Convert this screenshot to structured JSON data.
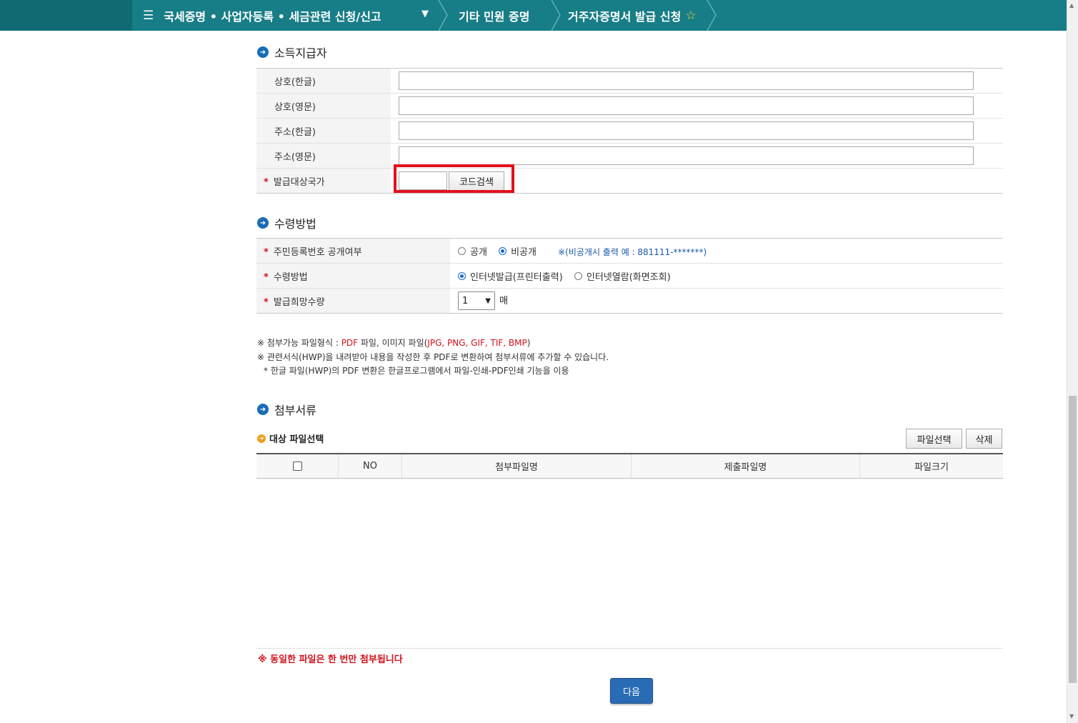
{
  "nav": {
    "menu_label": "국세증명 • 사업자등록 • 세금관련 신청/신고",
    "item2": "기타 민원 증명",
    "item3": "거주자증명서 발급 신청",
    "icons": {
      "menu": "hamburger-icon",
      "dropdown": "chevron-down-icon",
      "favorite": "star-icon"
    }
  },
  "payer_section": {
    "title": "소득지급자",
    "rows": [
      {
        "label": "상호(한글)",
        "value": ""
      },
      {
        "label": "상호(영문)",
        "value": ""
      },
      {
        "label": "주소(한글)",
        "value": ""
      },
      {
        "label": "주소(영문)",
        "value": ""
      }
    ],
    "country": {
      "required_mark": "*",
      "label": "발급대상국가",
      "value": "",
      "search_button": "코드검색"
    }
  },
  "receive_section": {
    "title": "수령방법",
    "rrn": {
      "required_mark": "*",
      "label": "주민등록번호 공개여부",
      "options": [
        "공개",
        "비공개"
      ],
      "selected": "비공개",
      "note": "※(비공개시 출력 예 : 881111-*******)"
    },
    "method": {
      "required_mark": "*",
      "label": "수령방법",
      "options": [
        "인터넷발급(프린터출력)",
        "인터넷열람(화면조회)"
      ],
      "selected": "인터넷발급(프린터출력)"
    },
    "quantity": {
      "required_mark": "*",
      "label": "발급희망수량",
      "value": "1",
      "unit": "매"
    }
  },
  "notes": {
    "line1_prefix": "※ 첨부가능 파일형식 : ",
    "line1_pdf": "PDF",
    "line1_mid": " 파일, 이미지 파일(",
    "line1_images": "JPG, PNG, GIF, TIF, BMP",
    "line1_suffix": ")",
    "line2": "※ 관련서식(HWP)을 내려받아 내용을 작성한 후 PDF로 변환하여 첨부서류에 추가할 수 있습니다.",
    "line3": "* 한글 파일(HWP)의 PDF 변환은 한글프로그램에서 파일-인쇄-PDF인쇄 기능을 이용"
  },
  "attach_section": {
    "title": "첨부서류",
    "subtitle": "대상 파일선택",
    "select_button": "파일선택",
    "delete_button": "삭제",
    "columns": [
      "NO",
      "첨부파일명",
      "제출파일명",
      "파일크기"
    ],
    "rows": [],
    "dup_note": "※ 동일한 파일은 한 번만 첨부됩니다"
  },
  "next_button": "다음",
  "colors": {
    "nav_bg": "#177d86",
    "required": "#d0121b",
    "highlight_box": "#e2111b",
    "primary_button": "#2a6bb5"
  }
}
